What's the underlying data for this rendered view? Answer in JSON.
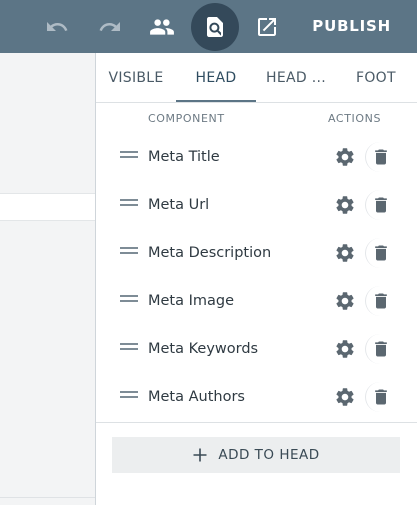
{
  "toolbar": {
    "icons": [
      "undo-icon",
      "redo-icon",
      "people-icon",
      "preview-icon",
      "open-external-icon"
    ],
    "publish_label": "PUBLISH",
    "colors": {
      "bar": "#5c7586",
      "active_button": "#34495a",
      "icon_dim": "#aebbc5"
    }
  },
  "panel": {
    "tabs": [
      {
        "label": "VISIBLE",
        "active": false
      },
      {
        "label": "HEAD",
        "active": true
      },
      {
        "label": "HEAD ...",
        "active": false
      },
      {
        "label": "FOOT",
        "active": false
      }
    ],
    "columns": {
      "component": "COMPONENT",
      "actions": "ACTIONS"
    },
    "rows": [
      {
        "label": "Meta Title"
      },
      {
        "label": "Meta Url"
      },
      {
        "label": "Meta Description"
      },
      {
        "label": "Meta Image"
      },
      {
        "label": "Meta Keywords"
      },
      {
        "label": "Meta Authors"
      }
    ],
    "add_label": "ADD TO HEAD"
  }
}
